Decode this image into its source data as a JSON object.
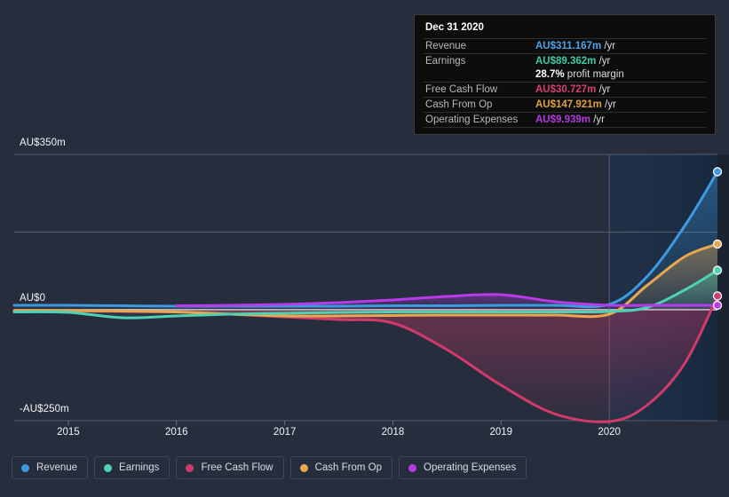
{
  "tooltip": {
    "title": "Dec 31 2020",
    "rows": [
      {
        "key": "Revenue",
        "amount": "AU$311.167m",
        "unit": "/yr",
        "color": "#4aa3e8"
      },
      {
        "key": "Earnings",
        "amount": "AU$89.362m",
        "unit": "/yr",
        "color": "#3fc9a8"
      },
      {
        "key": "Free Cash Flow",
        "amount": "AU$30.727m",
        "unit": "/yr",
        "color": "#d6406f"
      },
      {
        "key": "Cash From Op",
        "amount": "AU$147.921m",
        "unit": "/yr",
        "color": "#e0a044"
      },
      {
        "key": "Operating Expenses",
        "amount": "AU$9.939m",
        "unit": "/yr",
        "color": "#b23ae0"
      }
    ],
    "profit_margin": {
      "value": "28.7%",
      "label": "profit margin"
    }
  },
  "legend": {
    "items": [
      {
        "label": "Revenue",
        "color": "#3d9ae0"
      },
      {
        "label": "Earnings",
        "color": "#4fd1b5"
      },
      {
        "label": "Free Cash Flow",
        "color": "#d23a6b"
      },
      {
        "label": "Cash From Op",
        "color": "#e8a84f"
      },
      {
        "label": "Operating Expenses",
        "color": "#b83ae8"
      }
    ]
  },
  "chart_data": {
    "type": "line",
    "title": "",
    "xlabel": "",
    "ylabel": "",
    "currency": "AU$",
    "units": "millions",
    "grid": true,
    "legend_position": "bottom",
    "ylim": [
      -250,
      350
    ],
    "y_ticks": [
      350,
      175,
      0,
      -250
    ],
    "y_tick_labels": [
      "AU$350m",
      "",
      "AU$0",
      "-AU$250m"
    ],
    "x_ticks": [
      2015,
      2016,
      2017,
      2018,
      2019,
      2020
    ],
    "x_tick_labels": [
      "2015",
      "2016",
      "2017",
      "2018",
      "2019",
      "2020"
    ],
    "xlim": [
      2014.5,
      2021.0
    ],
    "forecast_start": 2020,
    "series": [
      {
        "name": "Revenue",
        "color": "#3d9ae0",
        "x": [
          2014.5,
          2015,
          2015.5,
          2016,
          2016.5,
          2017,
          2017.5,
          2018,
          2018.5,
          2019,
          2019.5,
          2020,
          2020.35,
          2020.7,
          2021.0
        ],
        "values": [
          10,
          10,
          9,
          8,
          8,
          8,
          8,
          9,
          9,
          10,
          10,
          12,
          75,
          190,
          311
        ]
      },
      {
        "name": "Earnings",
        "color": "#4fd1b5",
        "x": [
          2014.5,
          2015,
          2015.5,
          2016,
          2016.5,
          2017,
          2017.5,
          2018,
          2018.5,
          2019,
          2019.5,
          2020,
          2020.35,
          2020.7,
          2021.0
        ],
        "values": [
          -5,
          -6,
          -18,
          -14,
          -10,
          -8,
          -6,
          -5,
          -5,
          -5,
          -5,
          -4,
          5,
          45,
          89
        ]
      },
      {
        "name": "Free Cash Flow",
        "color": "#d23a6b",
        "x": [
          2014.5,
          2015,
          2015.5,
          2016,
          2016.5,
          2017,
          2017.5,
          2018,
          2018.5,
          2019,
          2019.5,
          2020,
          2020.35,
          2020.7,
          2021.0
        ],
        "values": [
          -2,
          -3,
          -4,
          -5,
          -10,
          -16,
          -22,
          -30,
          -90,
          -170,
          -235,
          -252,
          -215,
          -120,
          31
        ]
      },
      {
        "name": "Cash From Op",
        "color": "#e8a84f",
        "x": [
          2014.5,
          2015,
          2015.5,
          2016,
          2016.5,
          2017,
          2017.5,
          2018,
          2018.5,
          2019,
          2019.5,
          2020,
          2020.35,
          2020.7,
          2021.0
        ],
        "values": [
          -2,
          -2,
          -3,
          -5,
          -10,
          -14,
          -14,
          -13,
          -12,
          -12,
          -12,
          -10,
          55,
          120,
          148
        ]
      },
      {
        "name": "Operating Expenses",
        "color": "#b83ae8",
        "x": [
          2016,
          2016.5,
          2017,
          2017.5,
          2018,
          2018.5,
          2019,
          2019.5,
          2020,
          2020.35,
          2020.7,
          2021.0
        ],
        "values": [
          9,
          10,
          12,
          16,
          22,
          30,
          34,
          18,
          10,
          10,
          10,
          10
        ]
      }
    ]
  }
}
